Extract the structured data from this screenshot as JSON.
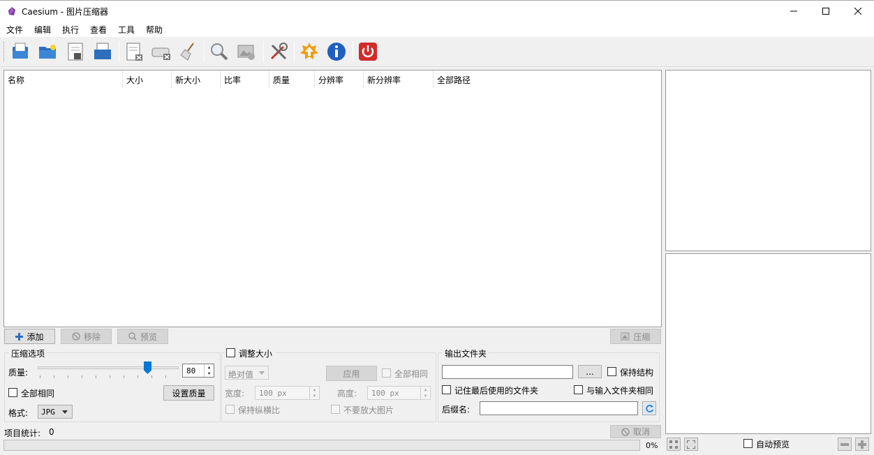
{
  "window": {
    "title": "Caesium - 图片压缩器"
  },
  "menu": [
    "文件",
    "编辑",
    "执行",
    "查看",
    "工具",
    "帮助"
  ],
  "toolbar": {
    "icons": [
      "open-files-icon",
      "open-folder-icon",
      "save-list-icon",
      "export-icon",
      "remove-item-icon",
      "clear-list-icon",
      "clean-icon",
      "preview-icon",
      "image-preview-icon",
      "settings-icon",
      "update-icon",
      "info-icon",
      "exit-icon"
    ]
  },
  "table": {
    "columns": [
      "名称",
      "大小",
      "新大小",
      "比率",
      "质量",
      "分辨率",
      "新分辨率",
      "全部路径"
    ],
    "rows": []
  },
  "actions": {
    "add": "添加",
    "remove": "移除",
    "preview": "预览",
    "compress": "压缩"
  },
  "compression": {
    "title": "压缩选项",
    "quality_label": "质量:",
    "quality_value": 80,
    "same_for_all": "全部相同",
    "set_quality": "设置质量",
    "format_label": "格式:",
    "format_value": "JPG"
  },
  "resize": {
    "title": "调整大小",
    "mode": "绝对值",
    "apply": "应用",
    "same_for_all": "全部相同",
    "width_label": "宽度:",
    "width_value": "100 px",
    "height_label": "高度:",
    "height_value": "100 px",
    "keep_aspect": "保持纵横比",
    "no_enlarge": "不要放大图片"
  },
  "output": {
    "title": "输出文件夹",
    "path_value": "",
    "browse": "...",
    "keep_structure": "保持结构",
    "remember_last": "记住最后使用的文件夹",
    "same_as_input": "与输入文件夹相同",
    "suffix_label": "后缀名:",
    "suffix_value": ""
  },
  "status": {
    "items_label": "项目统计:",
    "items_count": "0",
    "cancel": "取消",
    "progress_text": "0%",
    "progress": 0
  },
  "preview": {
    "auto_preview": "自动预览"
  },
  "colors": {
    "accent": "#0078d7",
    "exit_red": "#d22b2b",
    "update_orange": "#f39c12",
    "info_blue": "#1f5fbf"
  }
}
